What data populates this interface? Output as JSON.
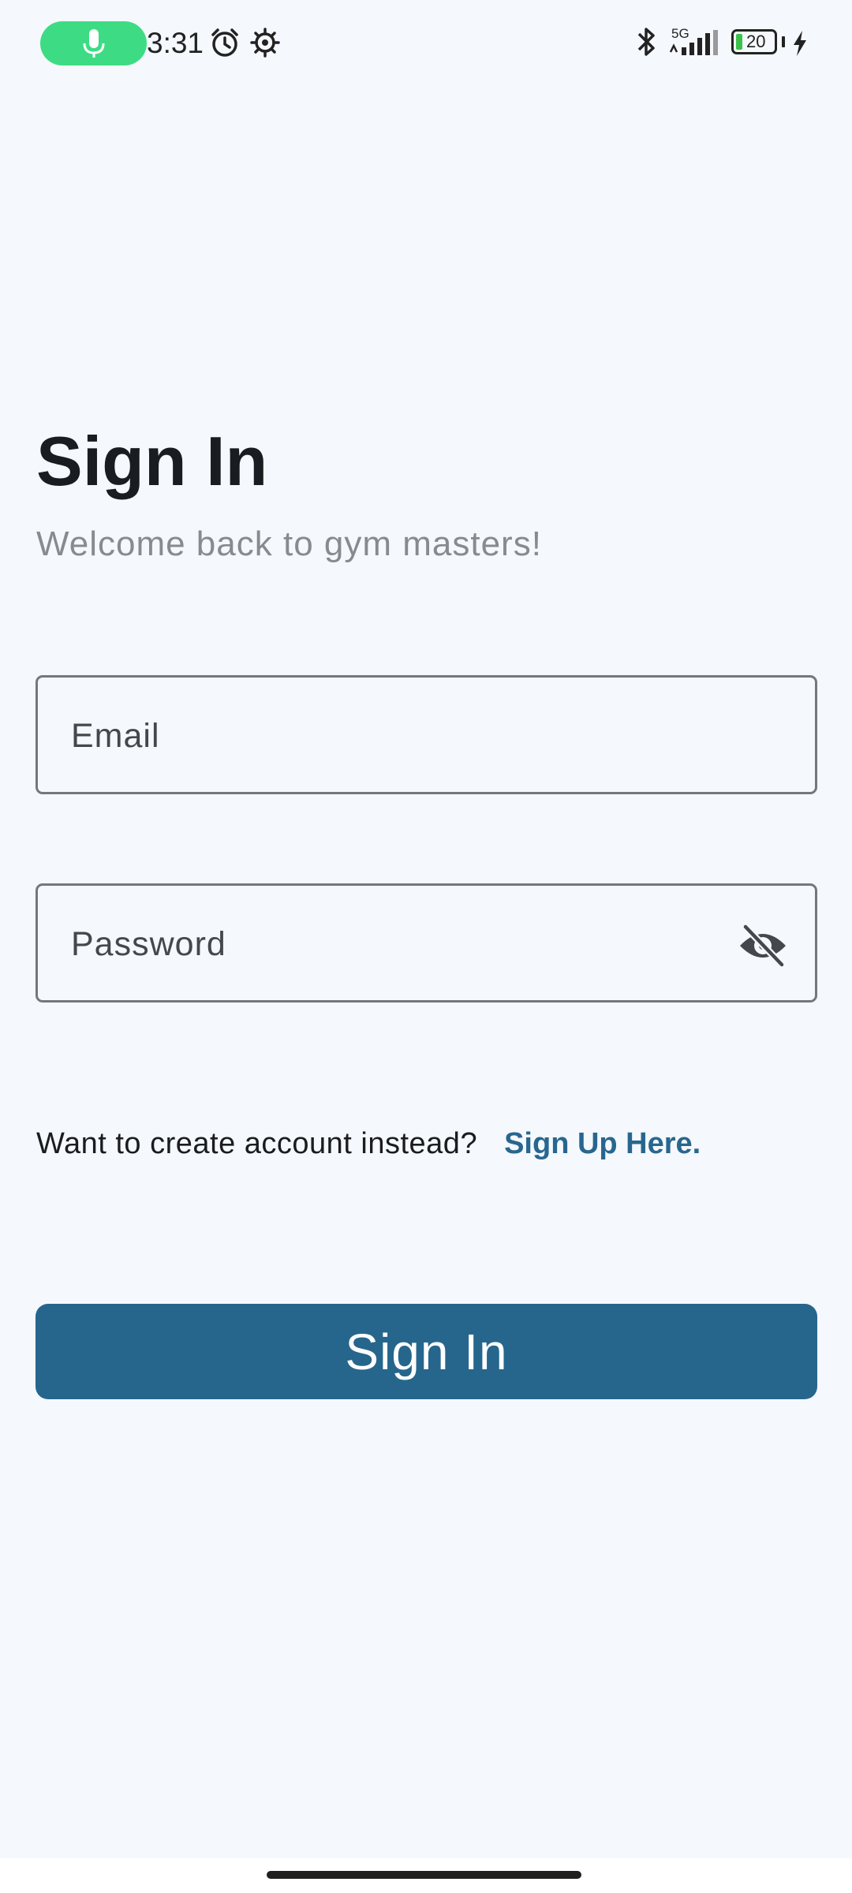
{
  "status_bar": {
    "time": "3:31",
    "network_label": "5G",
    "battery_level": "20",
    "icons": [
      "mic-icon",
      "alarm-icon",
      "settings-gear-icon",
      "bluetooth-icon",
      "signal-icon",
      "battery-icon",
      "charging-icon"
    ],
    "mic_pill_color": "#3ddc84"
  },
  "header": {
    "title": "Sign In",
    "subtitle": "Welcome back to gym masters!"
  },
  "form": {
    "email": {
      "placeholder": "Email",
      "value": ""
    },
    "password": {
      "placeholder": "Password",
      "value": "",
      "toggle_icon": "eye-off-icon"
    }
  },
  "signup": {
    "prompt": "Want to create account instead?",
    "link_label": "Sign Up Here."
  },
  "submit": {
    "label": "Sign In"
  },
  "colors": {
    "background": "#f5f8fc",
    "primary": "#26668c",
    "link": "#27678f",
    "subtitle": "#858b91",
    "outline": "#73777f"
  }
}
